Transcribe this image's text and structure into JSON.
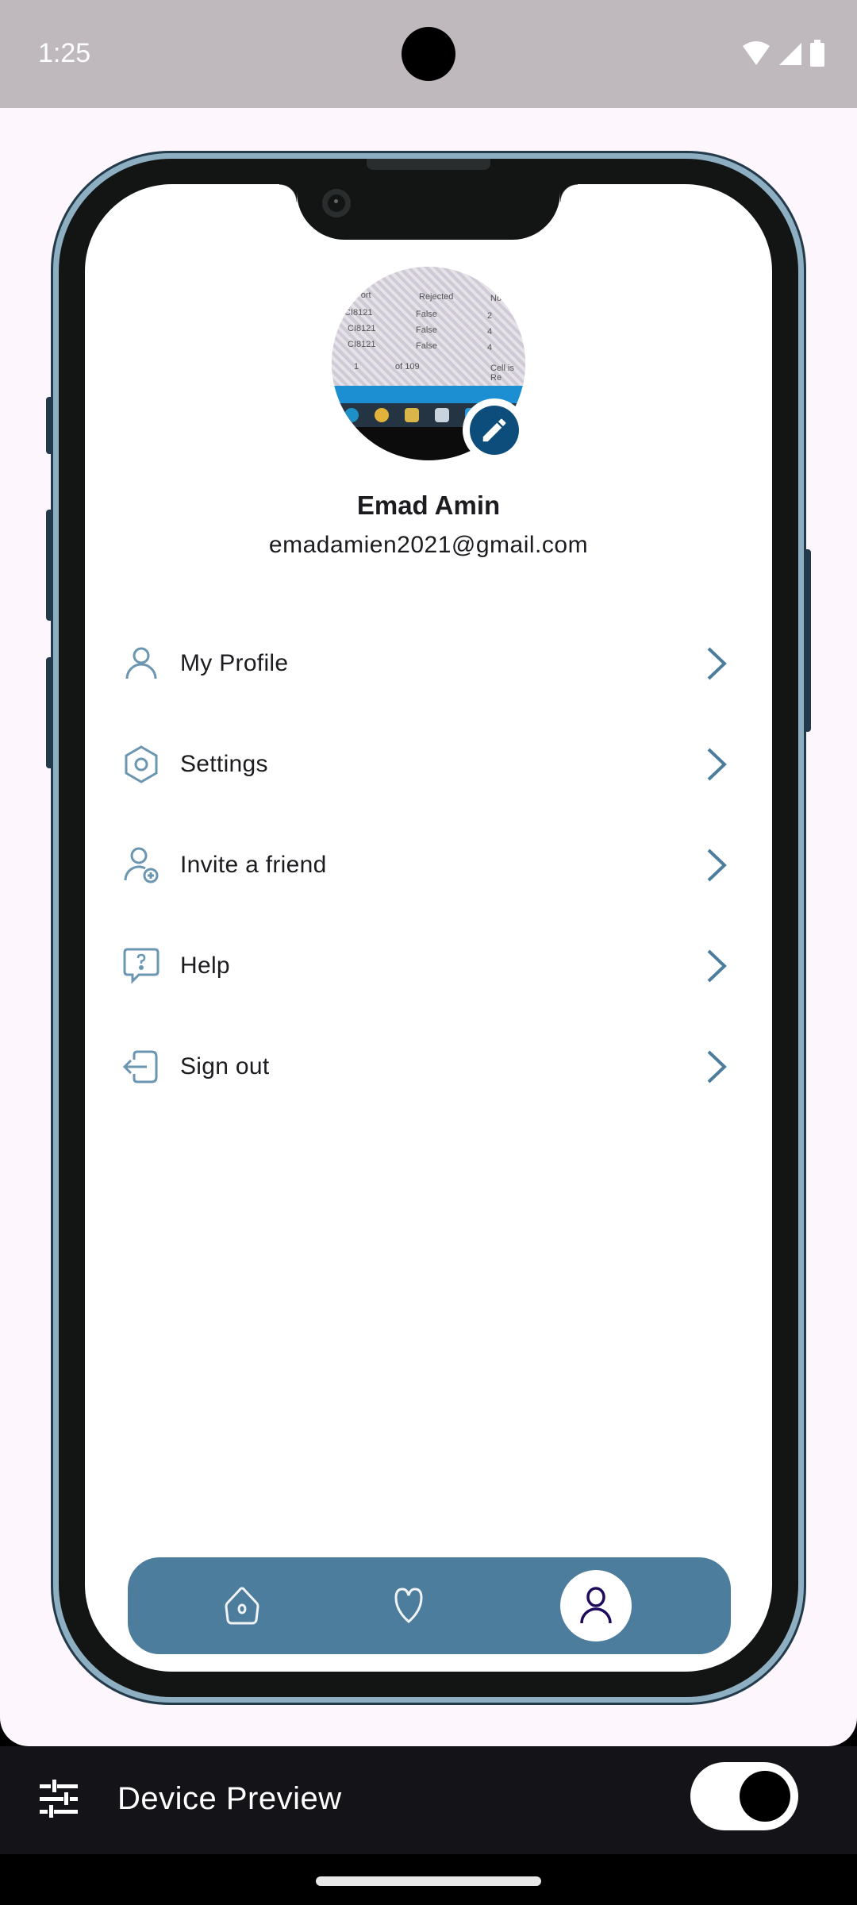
{
  "status_bar": {
    "time": "1:25",
    "icons": [
      "wifi-icon",
      "signal-icon",
      "battery-icon"
    ]
  },
  "profile": {
    "name": "Emad Amin",
    "email": "emadamien2021@gmail.com",
    "avatar_alt": "profile-photo",
    "avatar_photo_text": {
      "col1": "Fort",
      "col2": "Rejected",
      "col3": "No",
      "rows": [
        [
          "CI8121",
          "False",
          "2"
        ],
        [
          "CI8121",
          "False",
          "4"
        ],
        [
          "CI8121",
          "False",
          "4"
        ]
      ],
      "pager": "of 109",
      "pager_page": "1",
      "status": "Cell is Re"
    },
    "edit_icon": "pencil-icon"
  },
  "menu": {
    "items": [
      {
        "label": "My Profile",
        "icon": "user-icon"
      },
      {
        "label": "Settings",
        "icon": "settings-hexagon-icon"
      },
      {
        "label": "Invite a friend",
        "icon": "user-add-icon"
      },
      {
        "label": "Help",
        "icon": "help-chat-icon"
      },
      {
        "label": "Sign out",
        "icon": "sign-out-icon"
      }
    ],
    "chevron_icon": "chevron-right-icon"
  },
  "bottom_nav": {
    "items": [
      {
        "name": "home",
        "icon": "home-icon",
        "active": false
      },
      {
        "name": "favorites",
        "icon": "heart-icon",
        "active": false
      },
      {
        "name": "profile",
        "icon": "user-icon",
        "active": true
      }
    ]
  },
  "device_preview": {
    "label": "Device Preview",
    "icon": "sliders-icon",
    "toggle_on": true
  },
  "colors": {
    "accent": "#4d7d9c",
    "menu_icon": "#6a96b2",
    "edit_button": "#0d4d7c",
    "active_nav_icon": "#1f0a5c",
    "text": "#1c1b1f",
    "frame_accent": "#8eaec2",
    "canvas_bg": "#fdf6fd"
  }
}
